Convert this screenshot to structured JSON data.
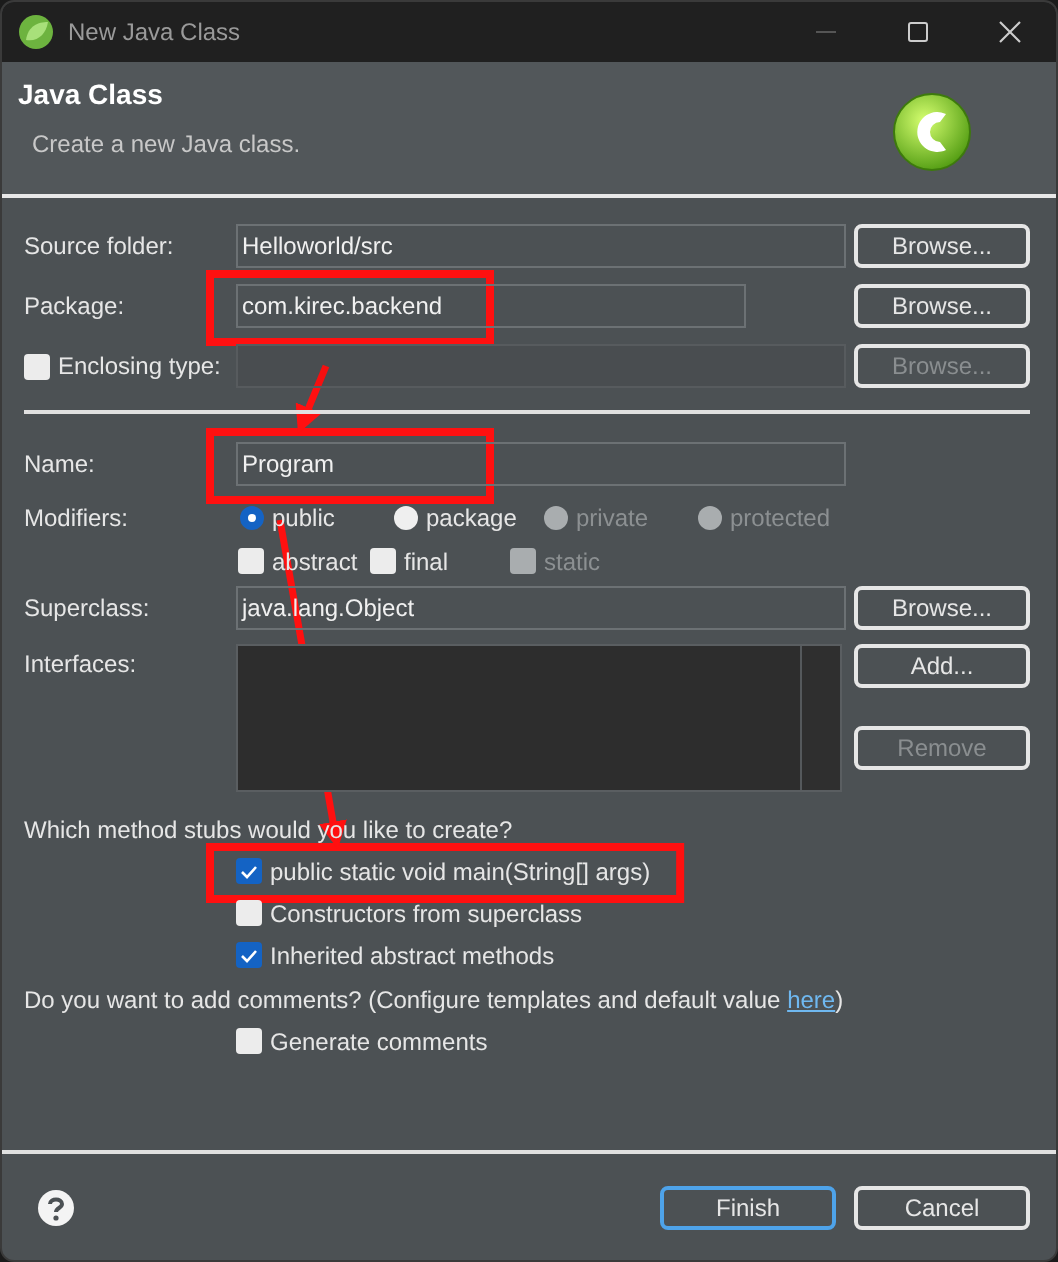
{
  "window": {
    "title": "New Java Class"
  },
  "header": {
    "title": "Java Class",
    "description": "Create a new Java class."
  },
  "type_fields": [
    {
      "kind": "field",
      "label": "Source folder:",
      "value": "Helloworld/src",
      "highlighted": false,
      "disabled": false,
      "button": {
        "label": "Browse...",
        "disabled": false
      }
    },
    {
      "kind": "short-field",
      "label": "Package:",
      "value": "com.kirec.backend",
      "highlighted": true,
      "disabled": false,
      "button": {
        "label": "Browse...",
        "disabled": false
      }
    },
    {
      "kind": "check-field",
      "label": "Enclosing type:",
      "checked": false,
      "highlighted": false,
      "disabled": true,
      "button": {
        "label": "Browse...",
        "disabled": true
      }
    }
  ],
  "name_field": {
    "label": "Name:",
    "value": "Program",
    "highlighted": true
  },
  "modifiers": {
    "label": "Modifiers:",
    "access": [
      {
        "label": "public",
        "selected": true,
        "disabled": false
      },
      {
        "label": "package",
        "selected": false,
        "disabled": false
      },
      {
        "label": "private",
        "selected": false,
        "disabled": true
      },
      {
        "label": "protected",
        "selected": false,
        "disabled": true
      }
    ],
    "flags": [
      {
        "label": "abstract",
        "checked": false,
        "disabled": false
      },
      {
        "label": "final",
        "checked": false,
        "disabled": false
      },
      {
        "label": "static",
        "checked": false,
        "disabled": true
      }
    ]
  },
  "superclass": {
    "label": "Superclass:",
    "value": "java.lang.Object",
    "button": {
      "label": "Browse...",
      "disabled": false
    }
  },
  "interfaces": {
    "label": "Interfaces:",
    "buttons": [
      {
        "label": "Add...",
        "disabled": false
      },
      {
        "label": "Remove",
        "disabled": true
      }
    ]
  },
  "stubs": {
    "question": "Which method stubs would you like to create?",
    "options": [
      {
        "label": "public static void main(String[] args)",
        "checked": true,
        "highlighted": true
      },
      {
        "label": "Constructors from superclass",
        "checked": false,
        "highlighted": false
      },
      {
        "label": "Inherited abstract methods",
        "checked": true,
        "highlighted": false
      }
    ]
  },
  "comments": {
    "text": "Do you want to add comments? (Configure templates and default value ",
    "link": "here",
    "text_after": ")",
    "options": [
      {
        "label": "Generate comments",
        "checked": false
      }
    ]
  },
  "footer": {
    "buttons": [
      {
        "label": "Finish",
        "default": true,
        "disabled": false
      },
      {
        "label": "Cancel",
        "default": false,
        "disabled": false
      }
    ]
  }
}
